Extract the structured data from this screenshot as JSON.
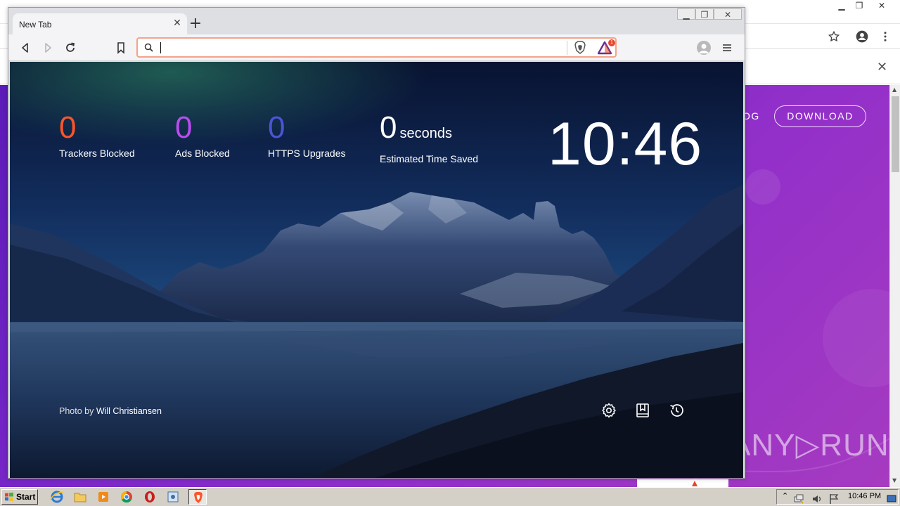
{
  "background_page": {
    "nav_partial_label": "OG",
    "download_label": "DOWNLOAD",
    "infobar_close": "✕",
    "watermark": "ANY▷RUN"
  },
  "brave": {
    "tab_title": "New Tab",
    "tab_close": "✕",
    "new_tab": "+",
    "omnibox_value": "",
    "omnibox_placeholder": "",
    "rewards_badge_count": "1",
    "window_buttons": {
      "minimize": "▁",
      "maximize": "❐",
      "close": "✕"
    }
  },
  "ntp": {
    "stats": [
      {
        "value": "0",
        "label": "Trackers Blocked",
        "color": "#fb542b"
      },
      {
        "value": "0",
        "label": "Ads Blocked",
        "color": "#b94cf0"
      },
      {
        "value": "0",
        "label": "HTTPS Upgrades",
        "color": "#4c54d2"
      },
      {
        "value": "0",
        "unit": "seconds",
        "label": "Estimated Time Saved",
        "color": "#ffffff"
      }
    ],
    "clock": "10:46",
    "photo_credit": {
      "prefix": "Photo by",
      "author": "Will Christiansen"
    },
    "actions": [
      "settings-icon",
      "bookmarks-icon",
      "history-icon"
    ]
  },
  "taskbar": {
    "start_label": "Start",
    "apps": [
      "internet-explorer-icon",
      "explorer-folder-icon",
      "media-player-icon",
      "chrome-icon",
      "opera-icon",
      "control-panel-icon",
      "brave-icon"
    ],
    "active_app": "brave-icon",
    "tray_time": "10:46 PM"
  },
  "colors": {
    "page_purple": "#7a27c9",
    "brave_orange": "#fb542b",
    "omnibox_focus": "#f3a38a"
  }
}
